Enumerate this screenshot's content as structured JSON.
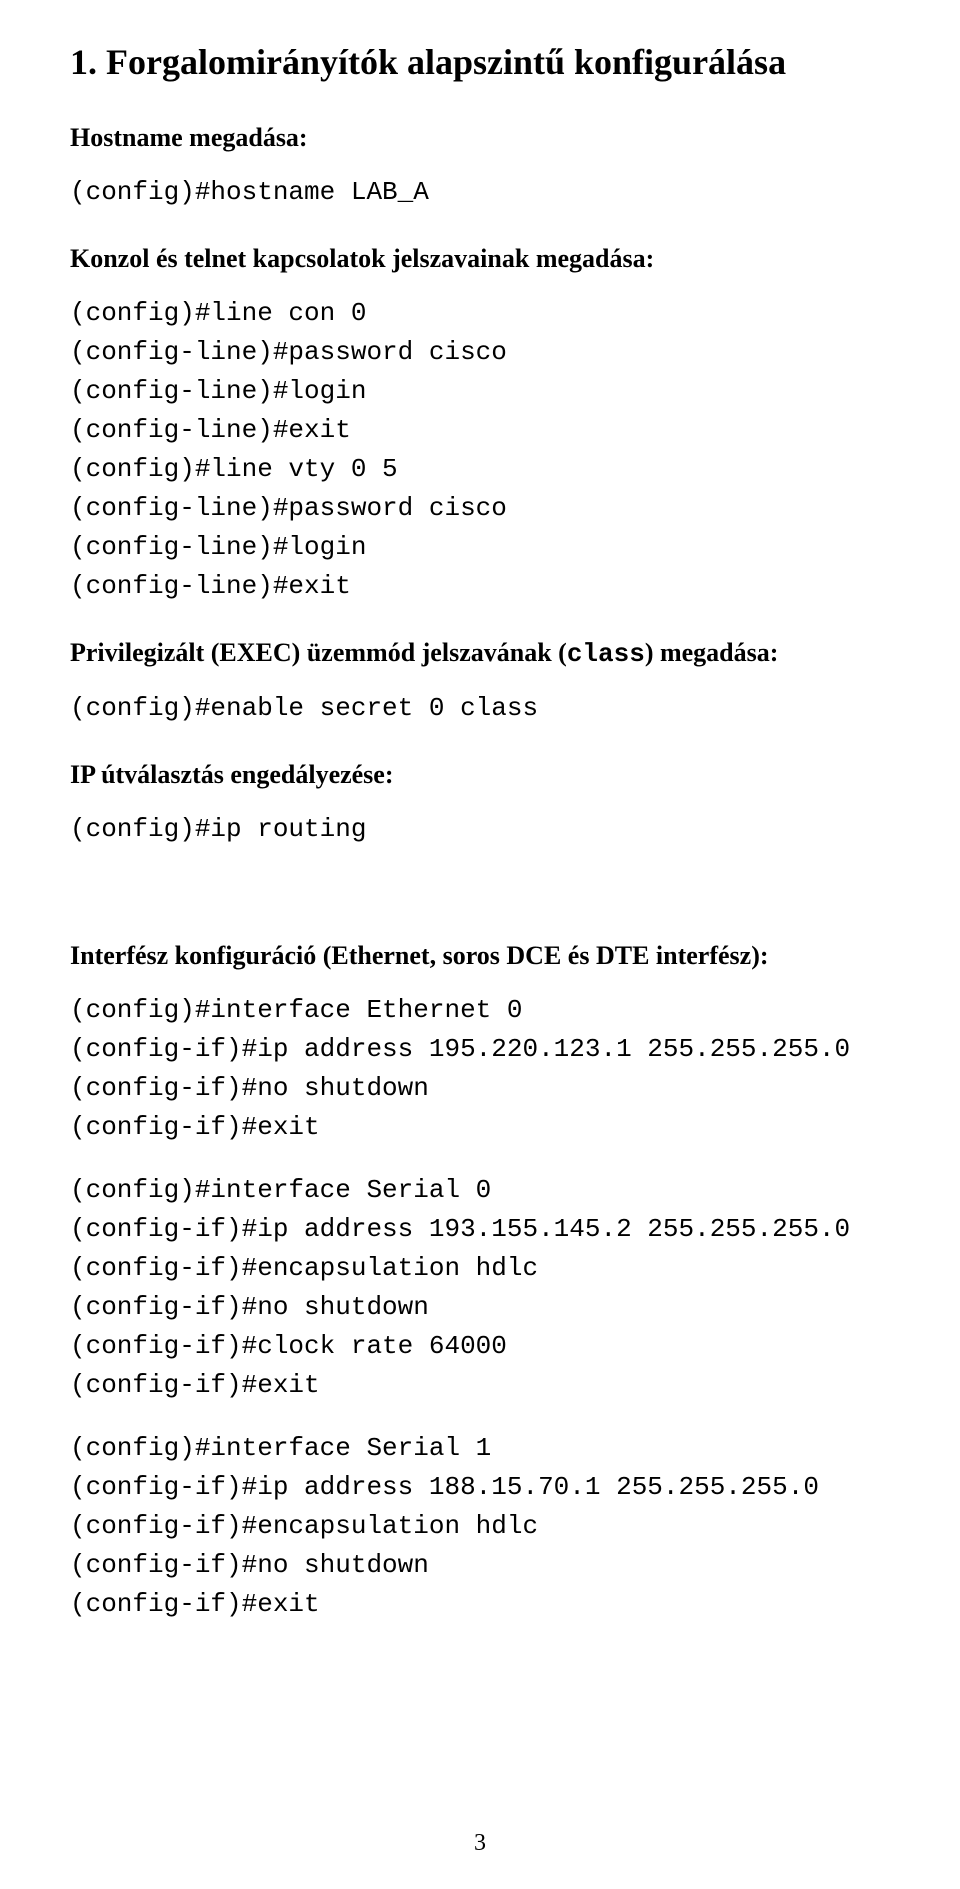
{
  "title": "1. Forgalomirányítók alapszintű konfigurálása",
  "h_hostname": "Hostname megadása:",
  "code_hostname": "(config)#hostname LAB_A",
  "h_konzol": "Konzol és telnet kapcsolatok jelszavainak megadása:",
  "code_konzol": "(config)#line con 0\n(config-line)#password cisco\n(config-line)#login\n(config-line)#exit\n(config)#line vty 0 5\n(config-line)#password cisco\n(config-line)#login\n(config-line)#exit",
  "h_priv_pre": "Privilegizált (EXEC) üzemmód jelszavának (",
  "h_priv_class": "class",
  "h_priv_post": ") megadása:",
  "code_priv": "(config)#enable secret 0 class",
  "h_ip": "IP útválasztás engedályezése:",
  "code_ip": "(config)#ip routing",
  "h_intf": "Interfész konfiguráció (Ethernet, soros DCE és DTE interfész):",
  "code_eth": "(config)#interface Ethernet 0\n(config-if)#ip address 195.220.123.1 255.255.255.0\n(config-if)#no shutdown\n(config-if)#exit",
  "code_s0": "(config)#interface Serial 0\n(config-if)#ip address 193.155.145.2 255.255.255.0\n(config-if)#encapsulation hdlc\n(config-if)#no shutdown\n(config-if)#clock rate 64000\n(config-if)#exit",
  "code_s1": "(config)#interface Serial 1\n(config-if)#ip address 188.15.70.1 255.255.255.0\n(config-if)#encapsulation hdlc\n(config-if)#no shutdown\n(config-if)#exit",
  "page_number": "3"
}
